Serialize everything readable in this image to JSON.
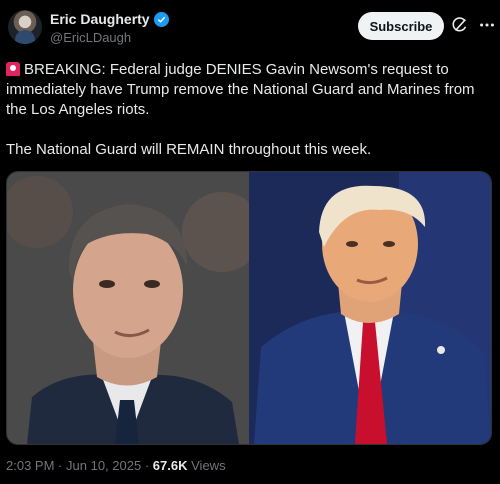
{
  "author": {
    "display_name": "Eric Daugherty",
    "handle": "@EricLDaugh"
  },
  "actions": {
    "subscribe_label": "Subscribe"
  },
  "tweet": {
    "paragraph1": "BREAKING: Federal judge DENIES Gavin Newsom's request to immediately have Trump remove the National Guard and Marines from the Los Angeles riots.",
    "paragraph2": "The National Guard will REMAIN throughout this week."
  },
  "meta": {
    "time": "2:03 PM",
    "date": "Jun 10, 2025",
    "separator": "·",
    "views_count": "67.6K",
    "views_label": "Views"
  },
  "icons": {
    "verified": "verified-badge-icon",
    "grok": "grok-icon",
    "more": "more-icon",
    "siren": "siren-emoji-icon"
  },
  "colors": {
    "background": "#000000",
    "text": "#e7e9ea",
    "muted": "#71767b",
    "verified": "#1d9bf0",
    "subscribe_bg": "#eff3f4"
  }
}
